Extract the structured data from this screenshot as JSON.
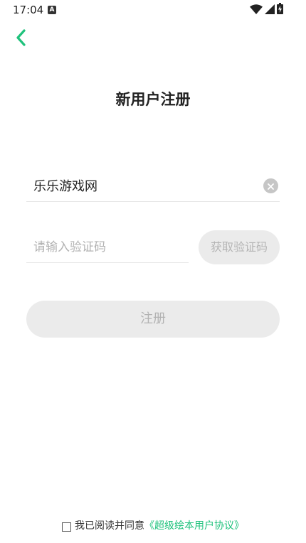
{
  "status_bar": {
    "time": "17:04",
    "notification_icon_letter": "A",
    "icons": [
      "wifi-icon",
      "cellular-signal-icon",
      "battery-charging-icon"
    ]
  },
  "header": {
    "back_icon": "chevron-left-icon",
    "title": "新用户注册"
  },
  "form": {
    "username_value": "乐乐游戏网",
    "code_placeholder": "请输入验证码",
    "code_value": "",
    "get_code_label": "获取验证码",
    "register_label": "注册"
  },
  "agreement": {
    "checked": false,
    "prefix": "我已阅读并同意",
    "link_text": "《超级绘本用户协议》"
  },
  "colors": {
    "accent": "#1fc27c",
    "disabled_bg": "#ebebeb",
    "disabled_text": "#b2b2b2"
  }
}
